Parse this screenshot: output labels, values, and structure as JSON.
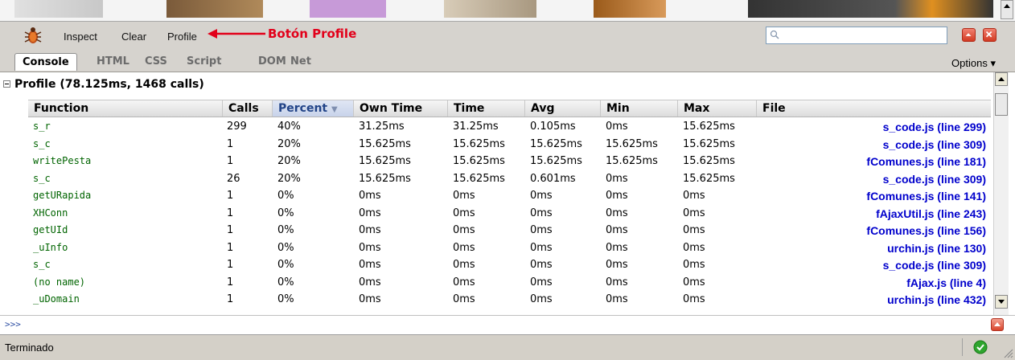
{
  "toolbar": {
    "inspect": "Inspect",
    "clear": "Clear",
    "profile": "Profile",
    "annotation": "Botón Profile",
    "search_value": ""
  },
  "tabs": [
    {
      "label": "Console",
      "active": true
    },
    {
      "label": "HTML",
      "active": false
    },
    {
      "label": "CSS",
      "active": false
    },
    {
      "label": "Script",
      "active": false
    },
    {
      "label": "DOM",
      "active": false
    },
    {
      "label": "Net",
      "active": false
    }
  ],
  "options_label": "Options ▾",
  "profile": {
    "title": "Profile (78.125ms, 1468 calls)",
    "sorted_column": "Percent",
    "columns": [
      "Function",
      "Calls",
      "Percent",
      "Own Time",
      "Time",
      "Avg",
      "Min",
      "Max",
      "File"
    ],
    "rows": [
      {
        "fn": "s_r",
        "calls": "299",
        "percent": "40%",
        "own": "31.25ms",
        "time": "31.25ms",
        "avg": "0.105ms",
        "min": "0ms",
        "max": "15.625ms",
        "file": "s_code.js (line 299)"
      },
      {
        "fn": "s_c",
        "calls": "1",
        "percent": "20%",
        "own": "15.625ms",
        "time": "15.625ms",
        "avg": "15.625ms",
        "min": "15.625ms",
        "max": "15.625ms",
        "file": "s_code.js (line 309)"
      },
      {
        "fn": "writePesta",
        "calls": "1",
        "percent": "20%",
        "own": "15.625ms",
        "time": "15.625ms",
        "avg": "15.625ms",
        "min": "15.625ms",
        "max": "15.625ms",
        "file": "fComunes.js (line 181)"
      },
      {
        "fn": "s_c",
        "calls": "26",
        "percent": "20%",
        "own": "15.625ms",
        "time": "15.625ms",
        "avg": "0.601ms",
        "min": "0ms",
        "max": "15.625ms",
        "file": "s_code.js (line 309)"
      },
      {
        "fn": "getURapida",
        "calls": "1",
        "percent": "0%",
        "own": "0ms",
        "time": "0ms",
        "avg": "0ms",
        "min": "0ms",
        "max": "0ms",
        "file": "fComunes.js (line 141)"
      },
      {
        "fn": "XHConn",
        "calls": "1",
        "percent": "0%",
        "own": "0ms",
        "time": "0ms",
        "avg": "0ms",
        "min": "0ms",
        "max": "0ms",
        "file": "fAjaxUtil.js (line 243)"
      },
      {
        "fn": "getUId",
        "calls": "1",
        "percent": "0%",
        "own": "0ms",
        "time": "0ms",
        "avg": "0ms",
        "min": "0ms",
        "max": "0ms",
        "file": "fComunes.js (line 156)"
      },
      {
        "fn": "_uInfo",
        "calls": "1",
        "percent": "0%",
        "own": "0ms",
        "time": "0ms",
        "avg": "0ms",
        "min": "0ms",
        "max": "0ms",
        "file": "urchin.js (line 130)"
      },
      {
        "fn": "s_c",
        "calls": "1",
        "percent": "0%",
        "own": "0ms",
        "time": "0ms",
        "avg": "0ms",
        "min": "0ms",
        "max": "0ms",
        "file": "s_code.js (line 309)"
      },
      {
        "fn": "(no name)",
        "calls": "1",
        "percent": "0%",
        "own": "0ms",
        "time": "0ms",
        "avg": "0ms",
        "min": "0ms",
        "max": "0ms",
        "file": "fAjax.js (line 4)"
      },
      {
        "fn": "_uDomain",
        "calls": "1",
        "percent": "0%",
        "own": "0ms",
        "time": "0ms",
        "avg": "0ms",
        "min": "0ms",
        "max": "0ms",
        "file": "urchin.js (line 432)"
      }
    ]
  },
  "command_prompt": ">>>",
  "status": {
    "text": "Terminado"
  },
  "icons": {
    "firebug": "firebug-bug-icon",
    "search": "magnifier-icon",
    "minimize": "minimize-icon",
    "close": "close-icon",
    "status_ok": "check-icon"
  },
  "colors": {
    "annotation": "#e2001a",
    "function_names": "#006400",
    "file_links": "#0000cc",
    "chrome": "#d6d3ce"
  }
}
